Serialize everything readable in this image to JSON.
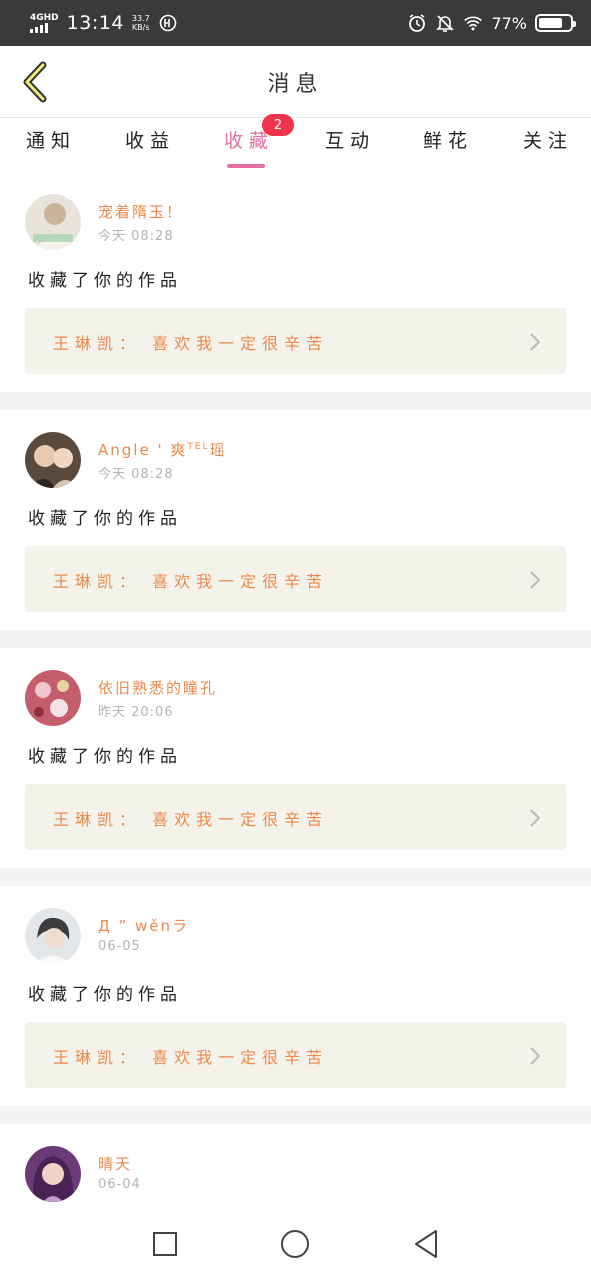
{
  "status_bar": {
    "network": "4GHD",
    "time": "13:14",
    "speed_value": "33.7",
    "speed_unit": "KB/s",
    "battery_pct": "77%",
    "battery_level": 0.77,
    "icons": [
      "signal-icon",
      "hd-voice-icon",
      "alarm-icon",
      "mute-icon",
      "wifi-icon",
      "battery-icon"
    ]
  },
  "header": {
    "title": "消息",
    "back_icon": "chevron-left-icon"
  },
  "tabs": [
    {
      "label": "通知"
    },
    {
      "label": "收益"
    },
    {
      "label": "收藏",
      "active": true,
      "badge": "2"
    },
    {
      "label": "互动"
    },
    {
      "label": "鲜花"
    },
    {
      "label": "关注"
    }
  ],
  "messages": [
    {
      "user": "宠着隋玉！",
      "time": "今天 08:28",
      "action": "收藏了你的作品",
      "work": "王琳凯： 喜欢我一定很辛苦"
    },
    {
      "user": "Angle ' 爽",
      "user_sup": "TEL",
      "user_tail": "瑶",
      "time": "今天 08:28",
      "action": "收藏了你的作品",
      "work": "王琳凯： 喜欢我一定很辛苦"
    },
    {
      "user": "依旧熟悉的瞳孔",
      "time": "昨天 20:06",
      "action": "收藏了你的作品",
      "work": "王琳凯： 喜欢我一定很辛苦"
    },
    {
      "user": "Д ” wěnラ",
      "time": "06-05",
      "action": "收藏了你的作品",
      "work": "王琳凯： 喜欢我一定很辛苦"
    },
    {
      "user": "晴天",
      "time": "06-04"
    }
  ],
  "colors": {
    "accent_pink": "#e36fa3",
    "badge_red": "#f0324b",
    "name_orange": "#ec8a4b",
    "work_bg": "#f3f3ec"
  },
  "nav_bar": {
    "icons": [
      "recent-apps-icon",
      "home-icon",
      "back-triangle-icon"
    ]
  }
}
